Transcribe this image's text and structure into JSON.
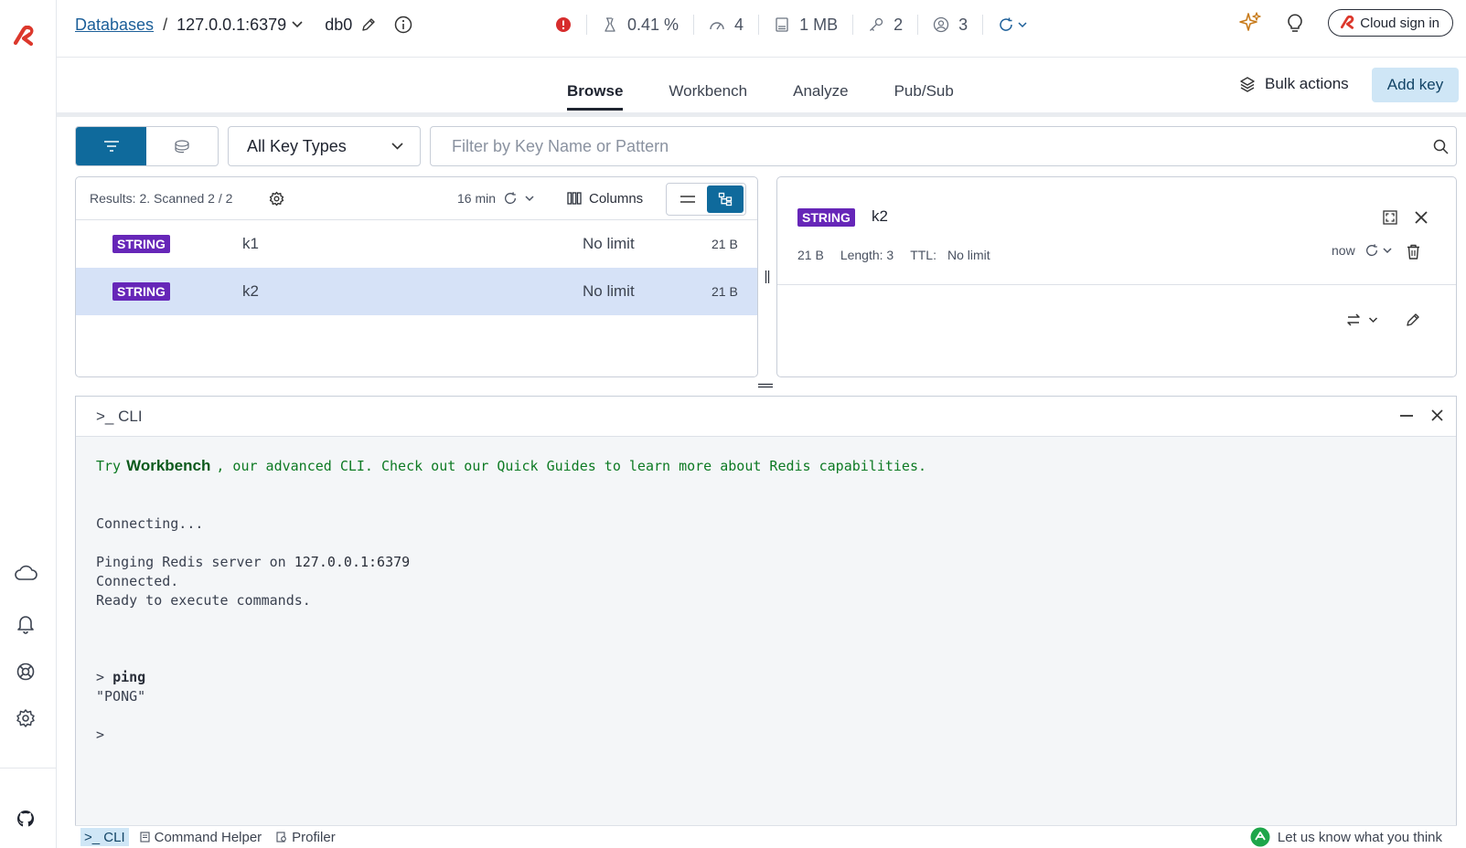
{
  "header": {
    "databases_link": "Databases",
    "separator": "/",
    "host": "127.0.0.1:6379",
    "db_name": "db0",
    "stats": [
      {
        "icon": "cpu-icon",
        "value": "0.41 %"
      },
      {
        "icon": "speedometer-icon",
        "value": "4"
      },
      {
        "icon": "memory-icon",
        "value": "1 MB"
      },
      {
        "icon": "key-icon",
        "value": "2"
      },
      {
        "icon": "users-icon",
        "value": "3"
      }
    ],
    "cloud_sign_in": "Cloud sign in"
  },
  "tabs": [
    "Browse",
    "Workbench",
    "Analyze",
    "Pub/Sub"
  ],
  "actions": {
    "bulk": "Bulk actions",
    "add_key": "Add key"
  },
  "filter": {
    "key_type": "All Key Types",
    "search_placeholder": "Filter by Key Name or Pattern"
  },
  "keylist": {
    "results": "Results: 2. Scanned 2 / 2",
    "refresh_age": "16 min",
    "columns_label": "Columns",
    "rows": [
      {
        "type": "STRING",
        "name": "k1",
        "ttl": "No limit",
        "size": "21 B",
        "selected": false
      },
      {
        "type": "STRING",
        "name": "k2",
        "ttl": "No limit",
        "size": "21 B",
        "selected": true
      }
    ]
  },
  "detail": {
    "type": "STRING",
    "name": "k2",
    "size": "21 B",
    "length": "Length: 3",
    "ttl_label": "TTL:",
    "ttl_value": "No limit",
    "refreshed": "now"
  },
  "cli": {
    "title": ">_ CLI",
    "try_prefix": "Try",
    "try_link": "Workbench",
    "try_suffix": ", our advanced CLI. Check out our Quick Guides to learn more about Redis capabilities.",
    "connecting": "Connecting...",
    "pinging_prefix": "Pinging Redis server on ",
    "pinging_host": "127.0.0.1:6379",
    "connected": "Connected.",
    "ready": "Ready to execute commands.",
    "prompt": ">",
    "command": "ping",
    "response": "\"PONG\""
  },
  "bottombar": {
    "cli": ">_ CLI",
    "command_helper": "Command Helper",
    "profiler": "Profiler",
    "feedback": "Let us know what you think"
  },
  "colors": {
    "accent": "#0f6a9c",
    "string_badge": "#6626b8",
    "selected_row": "#d6e2f7",
    "logo_red": "#dc382c",
    "cli_green": "#0d7a23"
  }
}
